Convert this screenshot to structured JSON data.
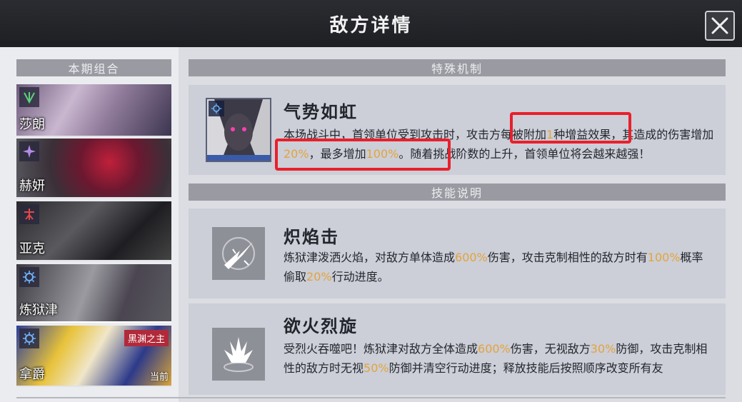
{
  "header": {
    "title": "敌方详情"
  },
  "left": {
    "section_title": "本期组合",
    "cards": [
      {
        "name": "莎朗",
        "icon": "leaf-element-icon"
      },
      {
        "name": "赫妍",
        "icon": "star-element-icon"
      },
      {
        "name": "亚克",
        "icon": "fire-element-icon"
      },
      {
        "name": "炼狱津",
        "icon": "sun-element-icon",
        "selected": true
      },
      {
        "name": "拿爵",
        "icon": "sun-element-icon",
        "tag": "黑渊之主",
        "status": "当前"
      }
    ]
  },
  "mechanic": {
    "section_title": "特殊机制",
    "title": "气势如虹",
    "desc_parts": [
      "本场战斗中，首领单位受到攻击时，攻击方每被附加",
      "1",
      "种增益效果，其造成的伤害增加",
      "20%",
      "，最多增加",
      "100%",
      "。随着挑战阶数的上升，首领单位将会越来越强！"
    ]
  },
  "skills": {
    "section_title": "技能说明",
    "items": [
      {
        "title": "炽焰击",
        "icon": "flame-strike-icon",
        "desc_parts": [
          "炼狱津泼洒火焰，对敌方单体造成",
          "600%",
          "伤害，攻击克制相性的敌方时有",
          "100%",
          "概率偷取",
          "20%",
          "行动进度。"
        ]
      },
      {
        "title": "欲火烈旋",
        "icon": "flame-burst-icon",
        "desc_parts": [
          "受烈火吞噬吧！炼狱津对敌方全体造成",
          "600%",
          "伤害，无视敌方",
          "30%",
          "防御，攻击克制相性的敌方时无视",
          "50%",
          "防御并清空行动进度；释放技能后按照顺序改变所有友"
        ]
      }
    ]
  },
  "colors": {
    "highlight": "#e3a43a",
    "annotation": "#e8202b"
  }
}
